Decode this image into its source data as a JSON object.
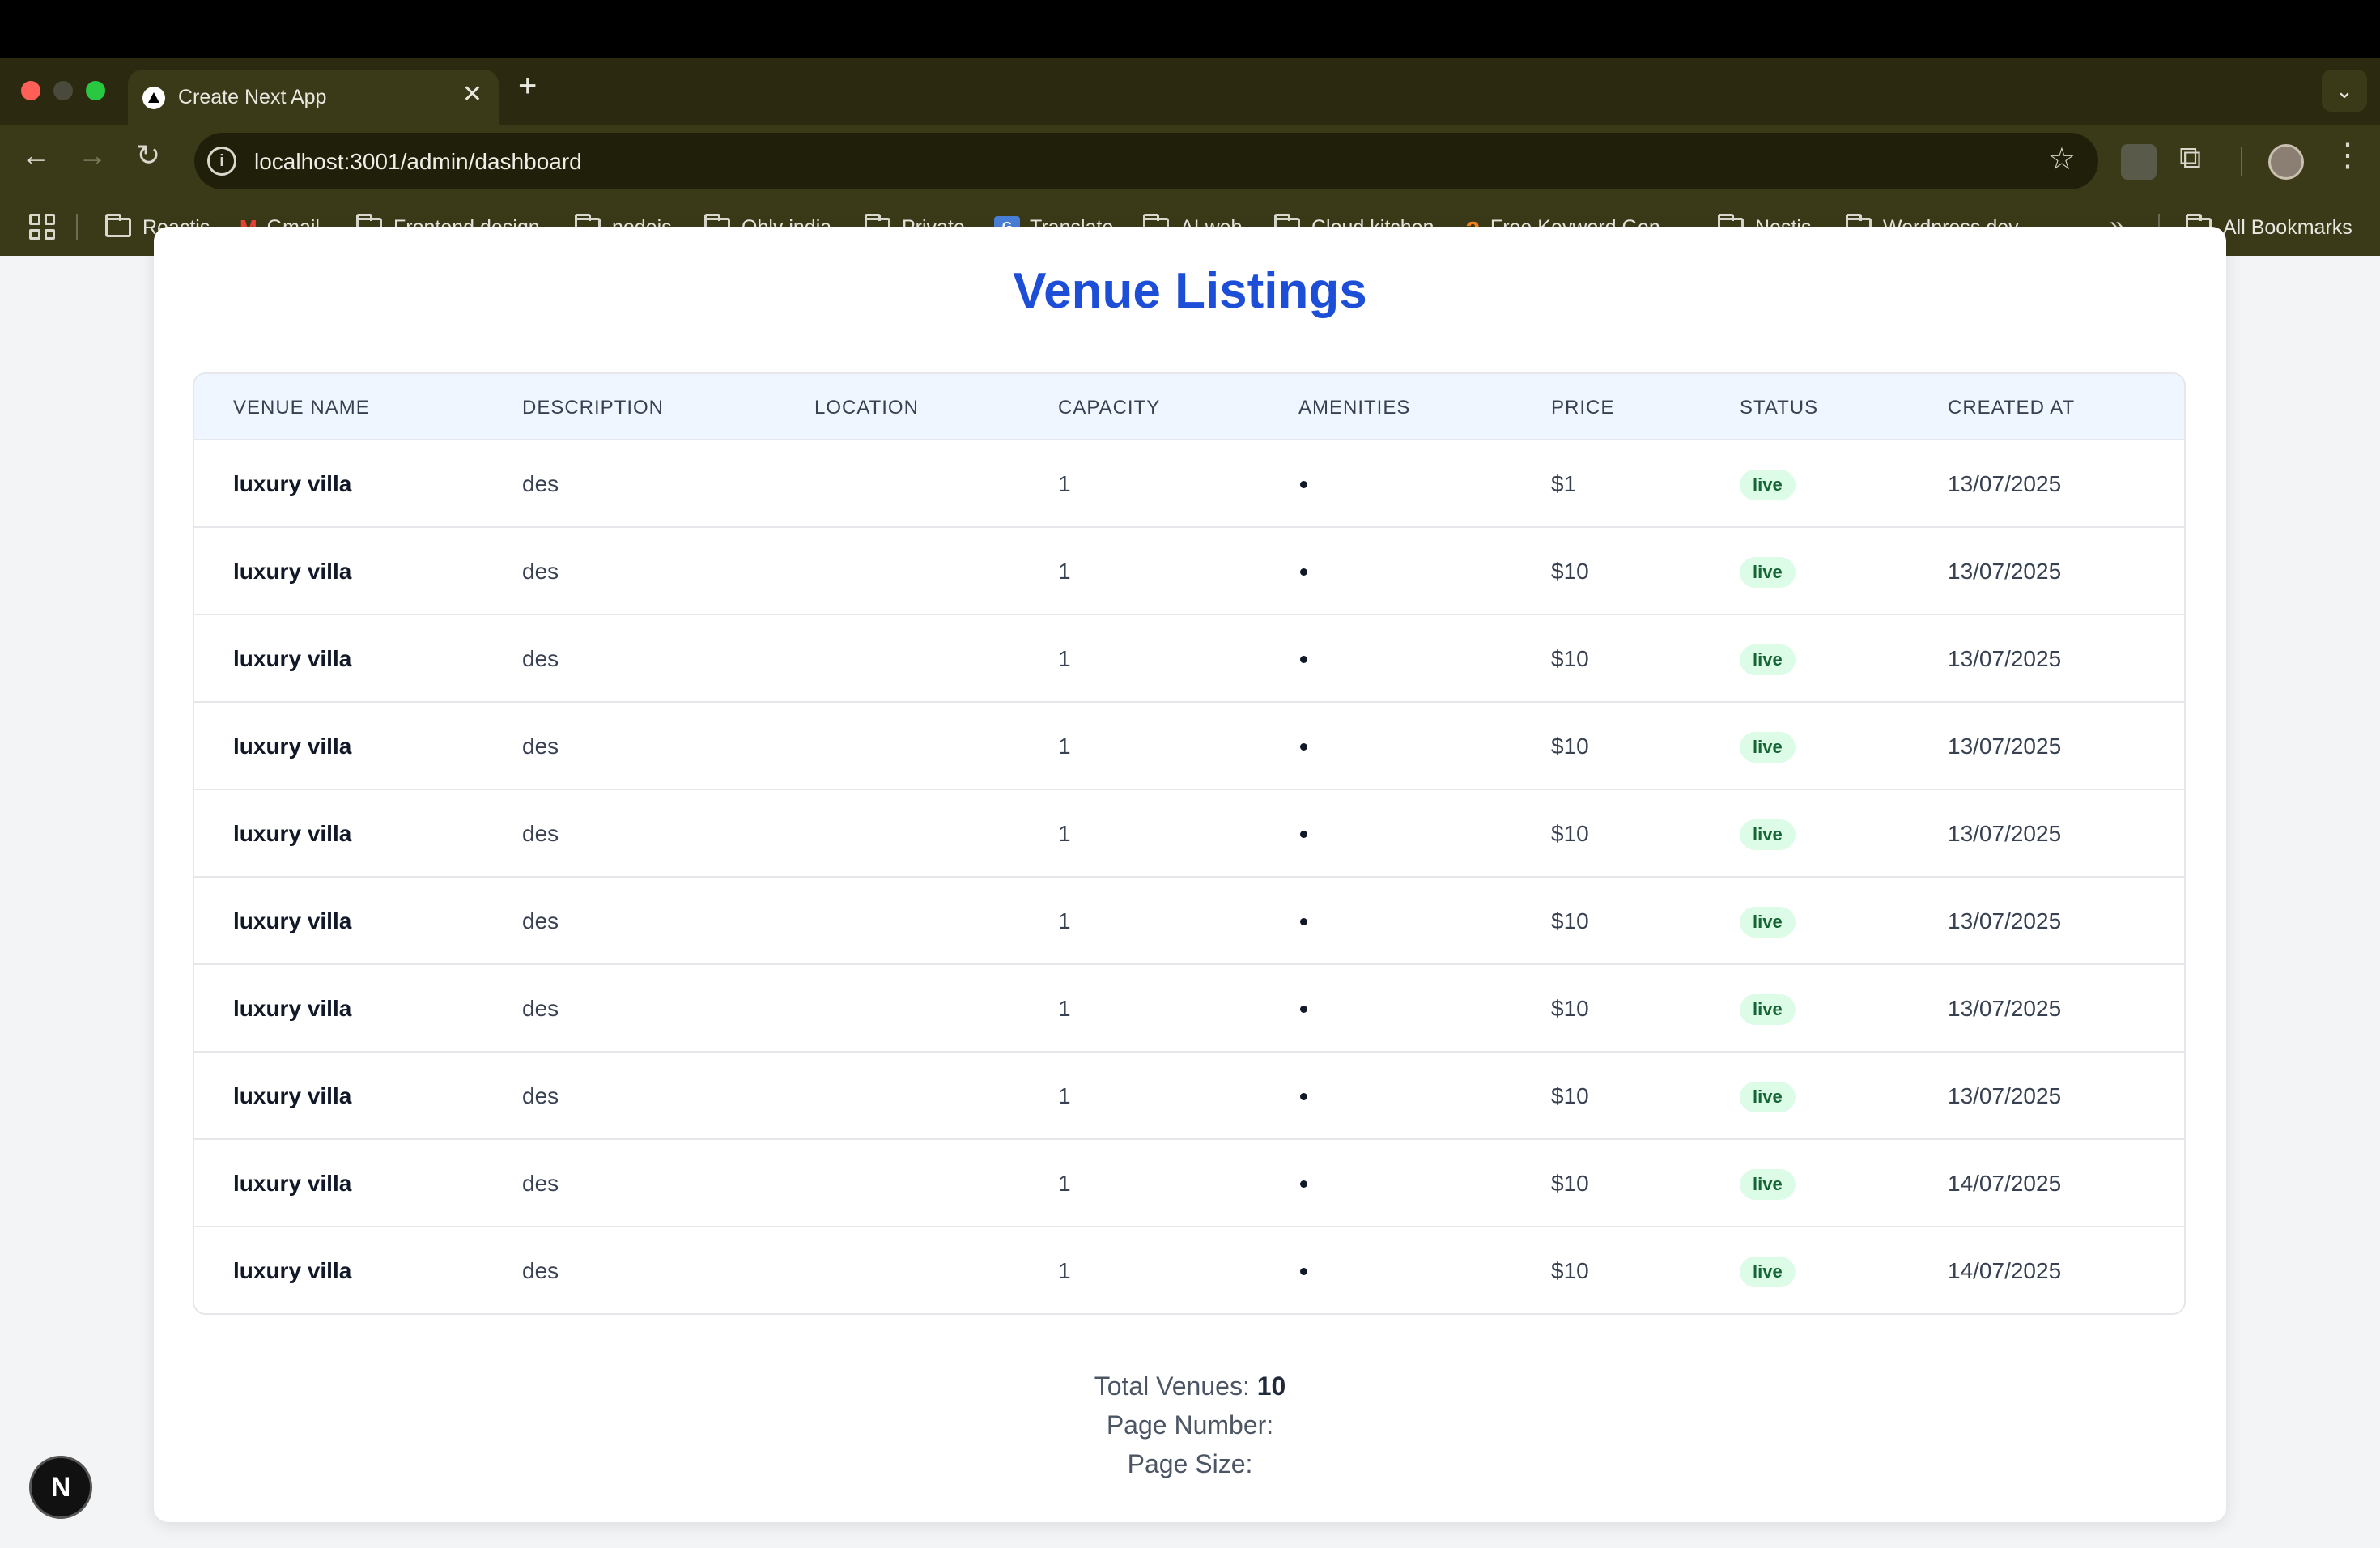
{
  "browser": {
    "tab_title": "Create Next App",
    "url": "localhost:3001/admin/dashboard",
    "bookmarks": [
      "Reactjs",
      "Gmail",
      "Frontend design",
      "nodejs",
      "Obly india",
      "Private",
      "Translate",
      "AI web",
      "Cloud kitchen",
      "Free Keyword Gen...",
      "Nestjs",
      "Wordpress dev"
    ],
    "all_bookmarks": "All Bookmarks",
    "more": "»"
  },
  "page": {
    "title": "Venue Listings",
    "columns": [
      "VENUE NAME",
      "DESCRIPTION",
      "LOCATION",
      "CAPACITY",
      "AMENITIES",
      "PRICE",
      "STATUS",
      "CREATED AT"
    ],
    "rows": [
      {
        "name": "luxury villa",
        "description": "des",
        "location": "",
        "capacity": "1",
        "price": "$1",
        "status": "live",
        "created": "13/07/2025"
      },
      {
        "name": "luxury villa",
        "description": "des",
        "location": "",
        "capacity": "1",
        "price": "$10",
        "status": "live",
        "created": "13/07/2025"
      },
      {
        "name": "luxury villa",
        "description": "des",
        "location": "",
        "capacity": "1",
        "price": "$10",
        "status": "live",
        "created": "13/07/2025"
      },
      {
        "name": "luxury villa",
        "description": "des",
        "location": "",
        "capacity": "1",
        "price": "$10",
        "status": "live",
        "created": "13/07/2025"
      },
      {
        "name": "luxury villa",
        "description": "des",
        "location": "",
        "capacity": "1",
        "price": "$10",
        "status": "live",
        "created": "13/07/2025"
      },
      {
        "name": "luxury villa",
        "description": "des",
        "location": "",
        "capacity": "1",
        "price": "$10",
        "status": "live",
        "created": "13/07/2025"
      },
      {
        "name": "luxury villa",
        "description": "des",
        "location": "",
        "capacity": "1",
        "price": "$10",
        "status": "live",
        "created": "13/07/2025"
      },
      {
        "name": "luxury villa",
        "description": "des",
        "location": "",
        "capacity": "1",
        "price": "$10",
        "status": "live",
        "created": "13/07/2025"
      },
      {
        "name": "luxury villa",
        "description": "des",
        "location": "",
        "capacity": "1",
        "price": "$10",
        "status": "live",
        "created": "14/07/2025"
      },
      {
        "name": "luxury villa",
        "description": "des",
        "location": "",
        "capacity": "1",
        "price": "$10",
        "status": "live",
        "created": "14/07/2025"
      }
    ],
    "footer": {
      "total_label": "Total Venues:",
      "total_value": "10",
      "page_number_label": "Page Number:",
      "page_size_label": "Page Size:"
    }
  },
  "next_badge": "N",
  "colors": {
    "title_blue": "#1d4ed8",
    "header_bg": "#eff6ff",
    "badge_bg": "#dcfce7",
    "badge_text": "#166534",
    "browser_chrome": "#3b3a18"
  }
}
